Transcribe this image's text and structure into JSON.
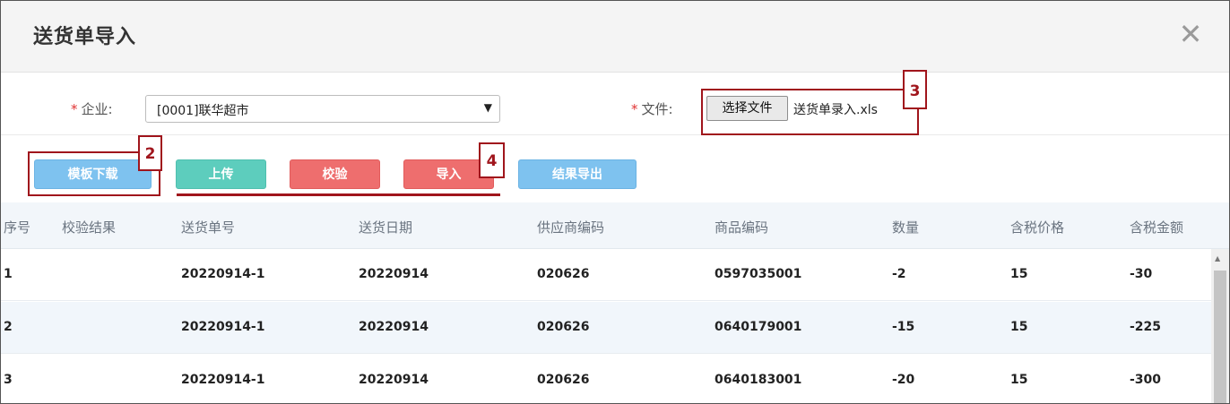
{
  "dialog": {
    "title": "送货单导入"
  },
  "form": {
    "company_label": "企业:",
    "company_value": "[0001]联华超市",
    "file_label": "文件:",
    "file_button": "选择文件",
    "file_name": "送货单录入.xls",
    "required_mark": "*"
  },
  "toolbar": {
    "template_download": "模板下载",
    "upload": "上传",
    "validate": "校验",
    "import": "导入",
    "export_results": "结果导出"
  },
  "annotations": [
    "2",
    "3",
    "4"
  ],
  "table": {
    "columns": [
      "序号",
      "校验结果",
      "送货单号",
      "送货日期",
      "供应商编码",
      "商品编码",
      "数量",
      "含税价格",
      "含税金额"
    ],
    "rows": [
      [
        "1",
        "",
        "20220914-1",
        "20220914",
        "020626",
        "0597035001",
        "-2",
        "15",
        "-30"
      ],
      [
        "2",
        "",
        "20220914-1",
        "20220914",
        "020626",
        "0640179001",
        "-15",
        "15",
        "-225"
      ],
      [
        "3",
        "",
        "20220914-1",
        "20220914",
        "020626",
        "0640183001",
        "-20",
        "15",
        "-300"
      ]
    ]
  },
  "colors": {
    "accent_annotation": "#a0151c",
    "button_blue": "#7ec2ef",
    "button_teal": "#5dcdbd",
    "button_red": "#ee6e6e"
  },
  "icons": {
    "close": "close-icon",
    "dropdown": "chevron-down-icon"
  }
}
